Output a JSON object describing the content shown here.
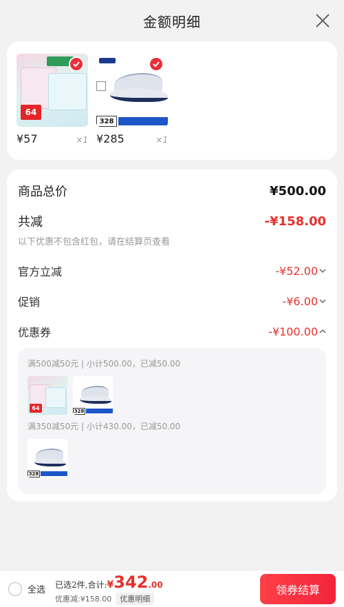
{
  "header": {
    "title": "金额明细"
  },
  "products": [
    {
      "price": "¥57",
      "qty": "×1"
    },
    {
      "price": "¥285",
      "qty": "×1"
    }
  ],
  "thumb_texts": {
    "wipes_price_tag": "64",
    "shoe_price_tag": "328"
  },
  "summary": {
    "total_label": "商品总价",
    "total_value": "¥500.00",
    "discount_label": "共减",
    "discount_value": "-¥158.00",
    "note": "以下优惠不包含红包，请在结算页查看"
  },
  "discounts": [
    {
      "label": "官方立减",
      "value": "-¥52.00",
      "expanded": false
    },
    {
      "label": "促销",
      "value": "-¥6.00",
      "expanded": false
    },
    {
      "label": "优惠券",
      "value": "-¥100.00",
      "expanded": true
    }
  ],
  "coupons": [
    {
      "line": "满500减50元 | 小计500.00，已减50.00"
    },
    {
      "line": "满350减50元 | 小计430.00，已减50.00"
    }
  ],
  "footer": {
    "select_all": "全选",
    "selected_label": "已选2件,合计:",
    "currency": "¥",
    "total_int": "342",
    "total_dec": ".00",
    "discount_text": "优惠减:¥158.00",
    "detail_button": "优惠明细",
    "pay_button": "领券结算"
  },
  "colors": {
    "accent": "#e5322d",
    "pay_button": "#f2243a",
    "background": "#f2f2f2"
  }
}
